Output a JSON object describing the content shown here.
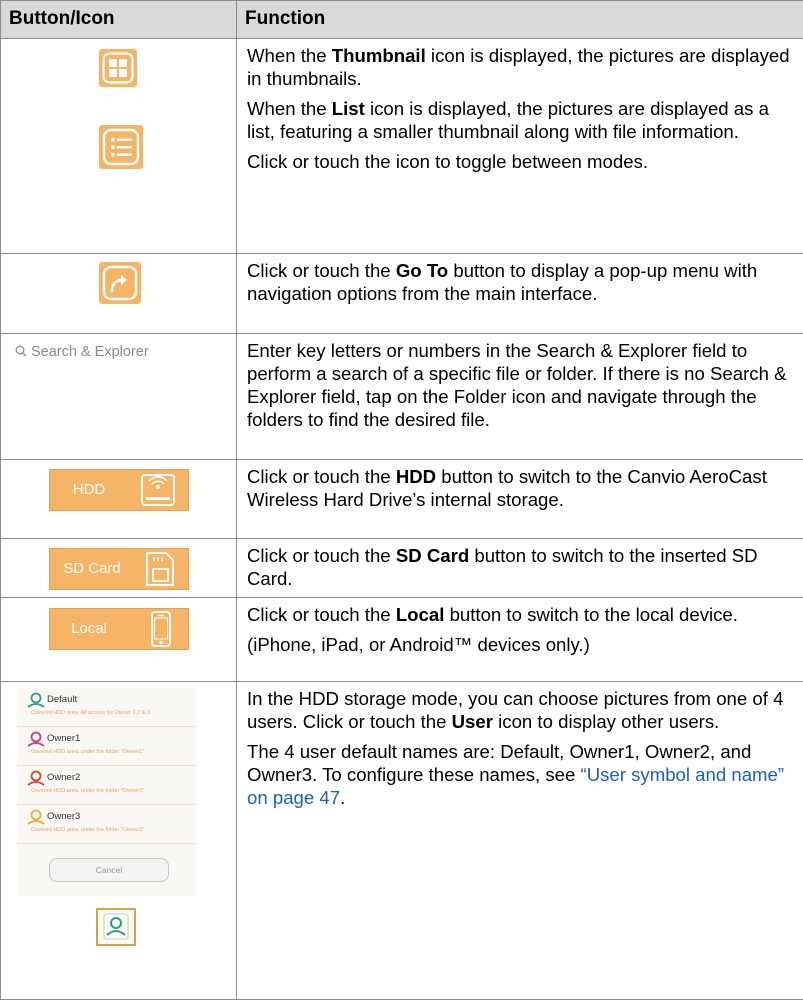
{
  "table": {
    "headers": [
      "Button/Icon",
      "Function"
    ],
    "rows": [
      {
        "icon": "thumbnail-list-icons",
        "paragraphs": [
          [
            "When the ",
            "Thumbnail",
            " icon is displayed, the pictures are displayed in thumbnails."
          ],
          [
            "When the ",
            "List",
            " icon is displayed, the pictures are displayed as a list, featuring a smaller thumbnail along with file information."
          ],
          [
            "Click or touch the icon to toggle between modes."
          ]
        ]
      },
      {
        "icon": "go-to-icon",
        "paragraphs": [
          [
            "Click or touch the ",
            "Go To",
            " button to display a pop-up menu with navigation options from the main interface."
          ]
        ]
      },
      {
        "icon": "search-field",
        "search_label": "Search & Explorer",
        "paragraphs": [
          [
            "Enter key letters or numbers in the Search & Explorer field to perform a search of a specific file or folder. If there is no Search & Explorer field, tap on the Folder icon and navigate through the folders to find the desired file."
          ]
        ]
      },
      {
        "icon": "hdd-button",
        "button_label": "HDD",
        "paragraphs": [
          [
            "Click or touch the ",
            "HDD",
            " button to switch to the Canvio AeroCast Wireless Hard Drive’s internal storage."
          ]
        ]
      },
      {
        "icon": "sd-card-button",
        "button_label": "SD Card",
        "paragraphs": [
          [
            "Click or touch the ",
            "SD Card",
            " button to switch to the inserted SD Card."
          ]
        ]
      },
      {
        "icon": "local-button",
        "button_label": "Local",
        "paragraphs": [
          [
            "Click or touch the ",
            "Local",
            " button to switch to the local device."
          ],
          [
            "(iPhone, iPad, or Android™ devices only.)"
          ]
        ]
      },
      {
        "icon": "user-menu",
        "users": [
          {
            "name": "Default",
            "note": "Covered HDD area. All access for Owner 1,2 & 3",
            "color": "#2a9d8f"
          },
          {
            "name": "Owner1",
            "note": "Covered HDD area, under the folder \"Owner1\"",
            "color": "#d63384"
          },
          {
            "name": "Owner2",
            "note": "Covered HDD area, under the folder \"Owner2\"",
            "color": "#d9432b"
          },
          {
            "name": "Owner3",
            "note": "Covered HDD area, under the folder \"Owner3\"",
            "color": "#f0a830"
          }
        ],
        "cancel_label": "Cancel",
        "paragraphs": [
          [
            "In the HDD storage mode, you can choose pictures from one of 4 users. Click or touch the ",
            "User",
            " icon to display other users."
          ],
          [
            "The 4 user default names are: Default, Owner1, Owner2, and Owner3. To configure these names, see ",
            "“User symbol and name” on page 47",
            "."
          ]
        ]
      }
    ]
  },
  "colors": {
    "accent_orange": "#f5b466",
    "link_blue": "#1a5fc7",
    "header_gray": "#d9d9d9"
  }
}
